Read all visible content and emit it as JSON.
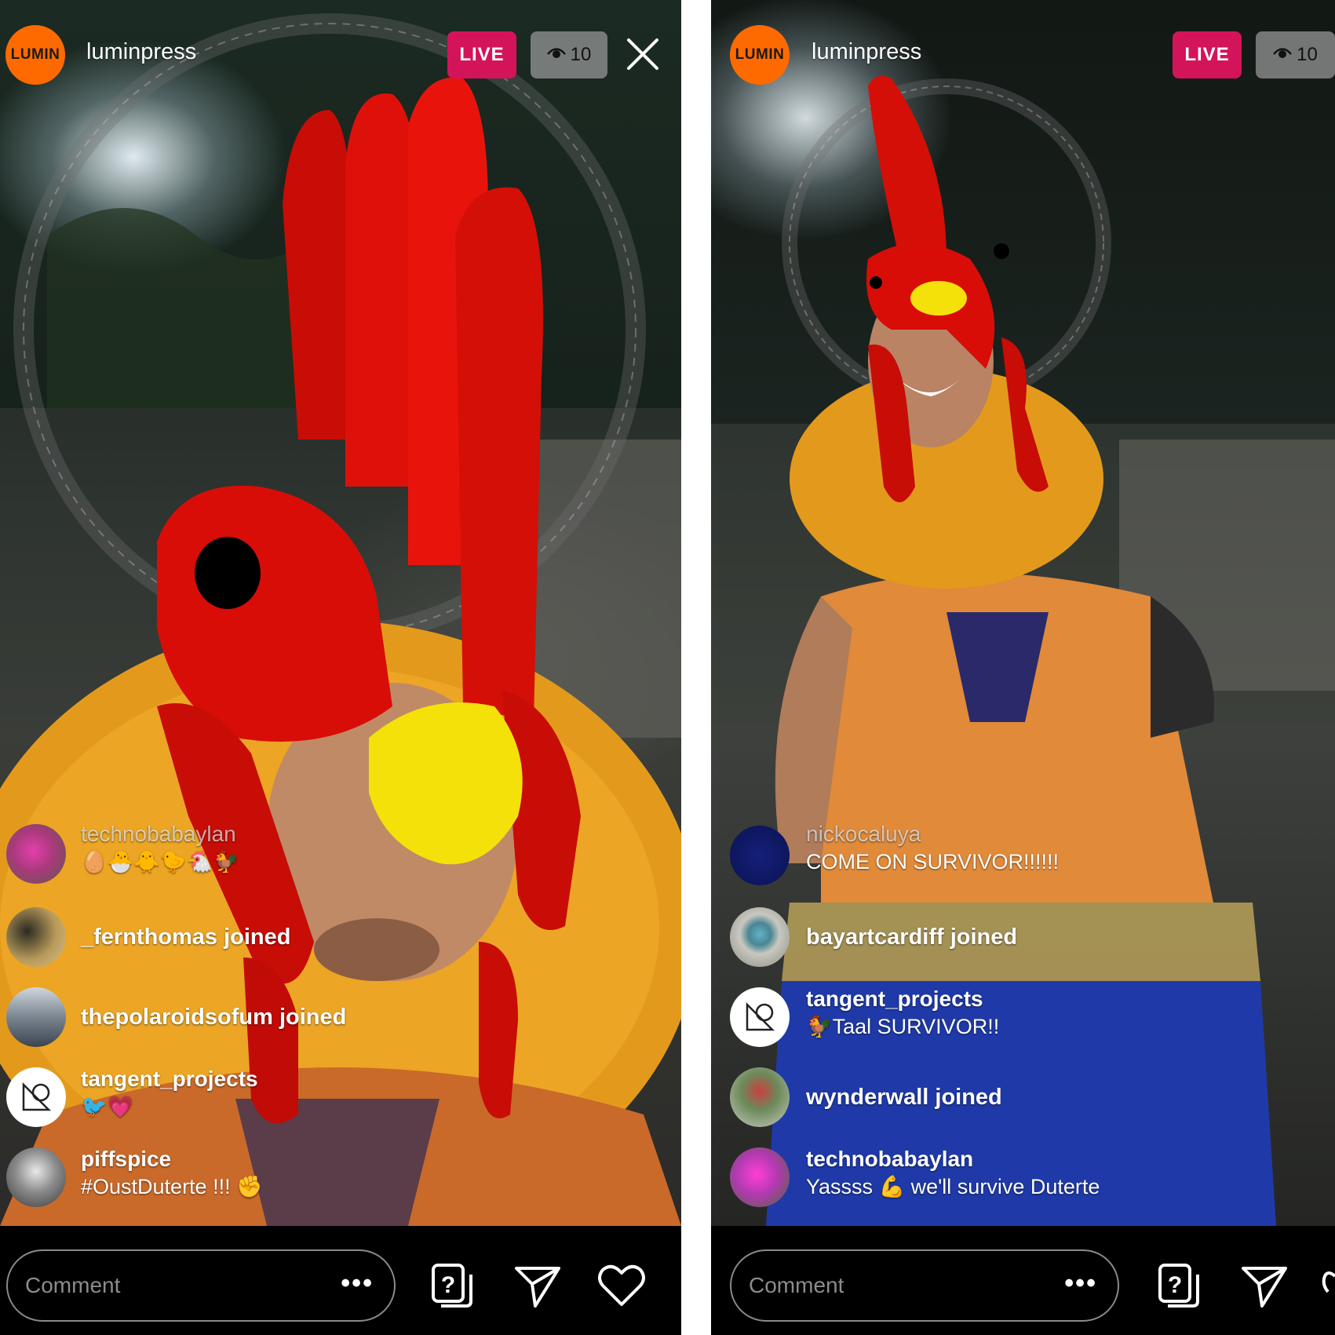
{
  "left": {
    "account": {
      "logo_text": "LUMIN",
      "username": "luminpress"
    },
    "live_label": "LIVE",
    "viewer_count": "10",
    "comments": [
      {
        "name": "technobabaylan",
        "message": "🥚🐣🐥🐤🐔🐓",
        "dim": true
      },
      {
        "joined": "_fernthomas joined"
      },
      {
        "joined": "thepolaroidsofum joined"
      },
      {
        "name": "tangent_projects",
        "message": "🐦💗"
      },
      {
        "name": "piffspice",
        "message": "#OustDuterte !!! ✊"
      }
    ],
    "comment_placeholder": "Comment",
    "more_label": "•••"
  },
  "right": {
    "account": {
      "logo_text": "LUMIN",
      "username": "luminpress"
    },
    "live_label": "LIVE",
    "viewer_count": "10",
    "comments": [
      {
        "name": "nickocaluya",
        "message": "COME ON SURVIVOR!!!!!!",
        "dim": true
      },
      {
        "joined": "bayartcardiff joined"
      },
      {
        "name": "tangent_projects",
        "message": "🐓Taal SURVIVOR!!"
      },
      {
        "joined": "wynderwall joined"
      },
      {
        "name": "technobabaylan",
        "message": "Yassss 💪 we'll survive Duterte"
      }
    ],
    "comment_placeholder": "Comment",
    "more_label": "•••"
  },
  "colors": {
    "live_badge": "#d4145a",
    "logo_bg": "#ff6a00",
    "rooster_red": "#d80d08",
    "beak_yellow": "#f4e10a",
    "feathers": "#e39a1c"
  },
  "icons": [
    "close-icon",
    "eye-icon",
    "question-sticker-icon",
    "send-icon",
    "heart-icon",
    "ellipsis-icon"
  ]
}
